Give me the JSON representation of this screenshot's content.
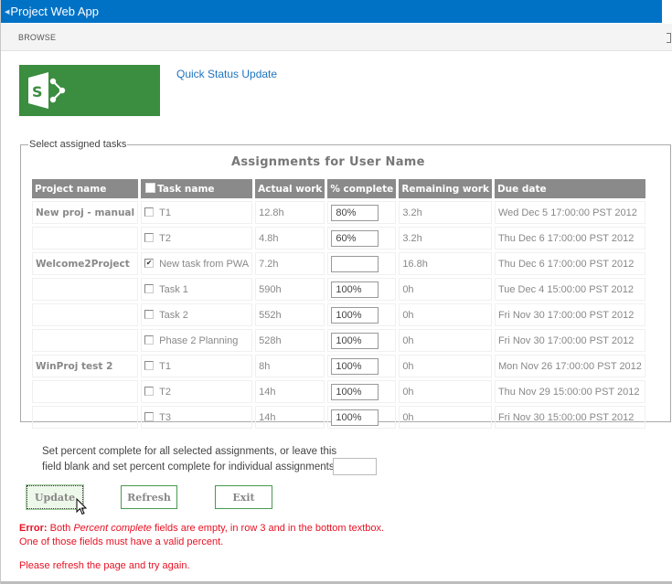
{
  "suite_bar": {
    "back_icon": "back-caret-icon",
    "title": "Project Web App",
    "color": "#0072c6"
  },
  "ribbon": {
    "tab": "BROWSE",
    "focus_icon": "focus-content-icon"
  },
  "site": {
    "logo_icon": "sharepoint-logo-icon",
    "logo_color": "#3b8d3f",
    "app_link": "Quick Status Update"
  },
  "tasks_panel": {
    "legend": "Select assigned tasks",
    "title": "Assignments for User Name",
    "columns": [
      "Project name",
      "Task name",
      "Actual work",
      "% complete",
      "Remaining work",
      "Due date"
    ],
    "rows": [
      {
        "project": "New proj - manual",
        "checked": false,
        "task": "T1",
        "actual_work": "12.8h",
        "percent_complete": "80%",
        "remaining_work": "3.2h",
        "due_date": "Wed Dec 5 17:00:00 PST 2012"
      },
      {
        "project": "",
        "checked": false,
        "task": "T2",
        "actual_work": "4.8h",
        "percent_complete": "60%",
        "remaining_work": "3.2h",
        "due_date": "Thu Dec 6 17:00:00 PST 2012"
      },
      {
        "project": "Welcome2Project",
        "checked": true,
        "task": "New task from PWA",
        "actual_work": "7.2h",
        "percent_complete": "",
        "remaining_work": "16.8h",
        "due_date": "Thu Dec 6 17:00:00 PST 2012"
      },
      {
        "project": "",
        "checked": false,
        "task": "Task 1",
        "actual_work": "590h",
        "percent_complete": "100%",
        "remaining_work": "0h",
        "due_date": "Tue Dec 4 15:00:00 PST 2012"
      },
      {
        "project": "",
        "checked": false,
        "task": "Task 2",
        "actual_work": "552h",
        "percent_complete": "100%",
        "remaining_work": "0h",
        "due_date": "Fri Nov 30 17:00:00 PST 2012"
      },
      {
        "project": "",
        "checked": false,
        "task": "Phase 2 Planning",
        "actual_work": "528h",
        "percent_complete": "100%",
        "remaining_work": "0h",
        "due_date": "Fri Nov 30 17:00:00 PST 2012"
      },
      {
        "project": "WinProj test 2",
        "checked": false,
        "task": "T1",
        "actual_work": "8h",
        "percent_complete": "100%",
        "remaining_work": "0h",
        "due_date": "Mon Nov 26 17:00:00 PST 2012"
      },
      {
        "project": "",
        "checked": false,
        "task": "T2",
        "actual_work": "14h",
        "percent_complete": "100%",
        "remaining_work": "0h",
        "due_date": "Thu Nov 29 15:00:00 PST 2012"
      },
      {
        "project": "",
        "checked": false,
        "task": "T3",
        "actual_work": "14h",
        "percent_complete": "100%",
        "remaining_work": "0h",
        "due_date": "Fri Nov 30 15:00:00 PST 2012"
      }
    ]
  },
  "bulk": {
    "line1": "Set percent complete for all selected assignments, or leave this",
    "line2": "field blank and set percent complete for individual assignments:",
    "value": ""
  },
  "buttons": {
    "update": "Update",
    "refresh": "Refresh",
    "exit": "Exit"
  },
  "error": {
    "label": "Error:",
    "part1": " Both ",
    "emphasis": "Percent complete",
    "part2": " fields are empty, in row 3 and in the bottom textbox.",
    "line2": "One of those fields must have a valid percent.",
    "retry": "Please refresh the page and try again.",
    "color": "#e81123"
  }
}
